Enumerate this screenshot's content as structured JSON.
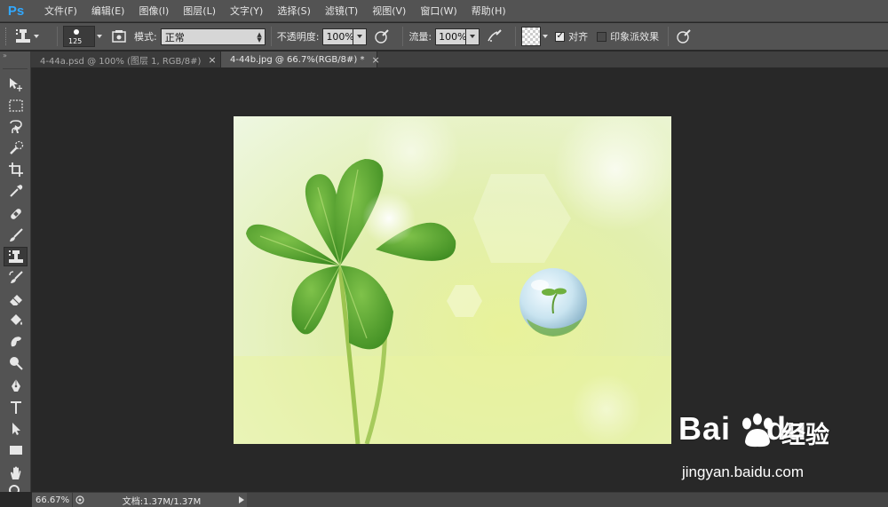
{
  "app": {
    "logo": "Ps"
  },
  "menu": [
    "文件(F)",
    "编辑(E)",
    "图像(I)",
    "图层(L)",
    "文字(Y)",
    "选择(S)",
    "滤镜(T)",
    "视图(V)",
    "窗口(W)",
    "帮助(H)"
  ],
  "options": {
    "brush_size": "125",
    "mode_label": "模式:",
    "mode_value": "正常",
    "opacity_label": "不透明度:",
    "opacity_value": "100%",
    "flow_label": "流量:",
    "flow_value": "100%",
    "align_label": "对齐",
    "align_checked": true,
    "impressionist_label": "印象派效果",
    "impressionist_checked": false
  },
  "tabs": [
    {
      "label": "4-44a.psd @ 100% (图层 1, RGB/8#)",
      "active": false,
      "close": "×"
    },
    {
      "label": "4-44b.jpg @ 66.7%(RGB/8#) *",
      "active": true,
      "close": "×"
    }
  ],
  "tools": [
    "move-tool-icon",
    "marquee-tool-icon",
    "lasso-tool-icon",
    "quick-selection-tool-icon",
    "crop-tool-icon",
    "eyedropper-tool-icon",
    "healing-brush-tool-icon",
    "brush-tool-icon",
    "pattern-stamp-tool-icon",
    "history-brush-tool-icon",
    "eraser-tool-icon",
    "paint-bucket-tool-icon",
    "smudge-tool-icon",
    "dodge-tool-icon",
    "pen-tool-icon",
    "type-tool-icon",
    "path-selection-tool-icon",
    "rectangle-tool-icon",
    "hand-tool-icon",
    "zoom-tool-icon"
  ],
  "active_tool": "pattern-stamp-tool-icon",
  "status": {
    "zoom": "66.67%",
    "doc_info": "文档:1.37M/1.37M"
  },
  "watermark": {
    "logo_left": "Bai",
    "logo_right": "du",
    "cn": "经验",
    "url": "jingyan.baidu.com"
  }
}
